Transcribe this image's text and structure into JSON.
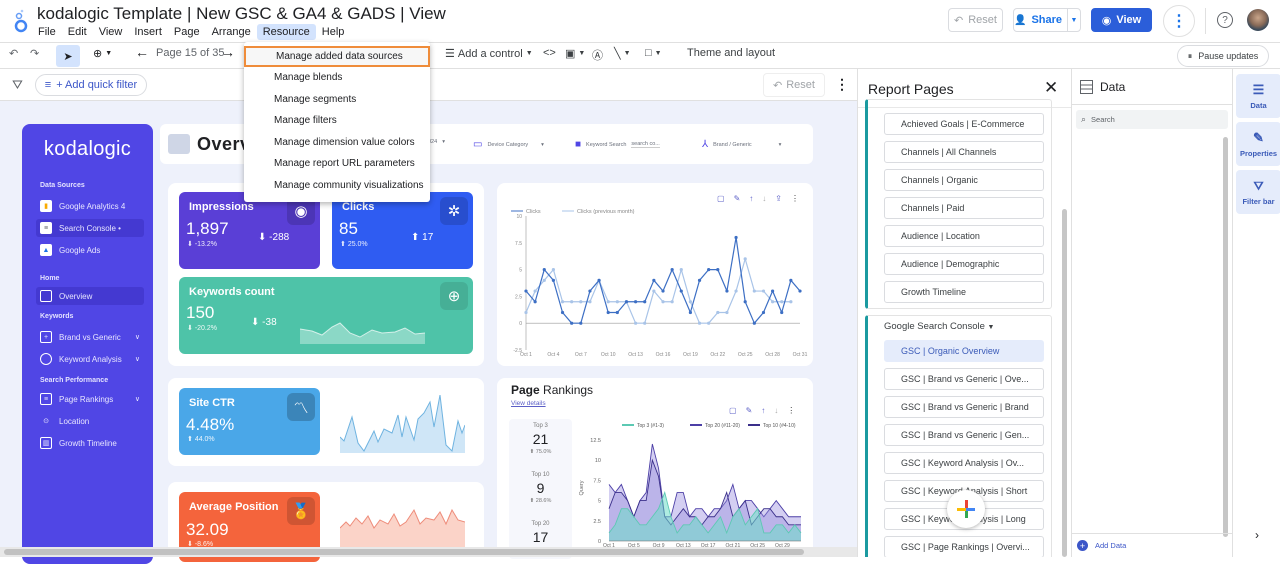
{
  "header": {
    "title": "kodalogic Template | New GSC & GA4 & GADS | View",
    "menus": [
      "File",
      "Edit",
      "View",
      "Insert",
      "Page",
      "Arrange",
      "Resource",
      "Help"
    ],
    "active_menu": "Resource",
    "reset_label": "Reset",
    "share_label": "Share",
    "view_label": "View"
  },
  "toolbar": {
    "page_indicator": "Page 15 of 35",
    "add_control_label": "Add a control",
    "theme_label": "Theme and layout",
    "pause_label": "Pause updates"
  },
  "filterbar": {
    "quick_filter_label": "+ Add quick filter",
    "reset_label": "Reset"
  },
  "resource_menu": {
    "items": [
      "Manage added data sources",
      "Manage blends",
      "Manage segments",
      "Manage filters",
      "Manage dimension value colors",
      "Manage report URL parameters",
      "Manage community visualizations"
    ],
    "highlighted": "Manage added data sources"
  },
  "report": {
    "logo": "kodalogic",
    "page_title": "Overview",
    "sidebar": {
      "sections": {
        "data_sources": "Data Sources",
        "home": "Home",
        "keywords": "Keywords",
        "search_performance": "Search Performance"
      },
      "items": {
        "ga4": "Google Analytics 4",
        "gsc": "Search Console •",
        "ads": "Google Ads",
        "overview": "Overview",
        "brand": "Brand vs Generic",
        "keyword_analysis": "Keyword Analysis",
        "page_rankings": "Page Rankings",
        "location": "Location",
        "growth": "Growth Timeline"
      }
    },
    "controls": {
      "date_fragment": "024",
      "device": "Device Category",
      "keyword_search": "Keyword Search",
      "keyword_placeholder": "search co...",
      "brand": "Brand / Generic"
    },
    "kpis": {
      "impressions": {
        "title": "Impressions",
        "value": "1,897",
        "pct": "-13.2%",
        "delta": "-288",
        "color": "#5a3fd6"
      },
      "clicks": {
        "title": "Clicks",
        "value": "85",
        "pct": "25.0%",
        "delta": "17",
        "color": "#2f5cf2"
      },
      "keywords": {
        "title": "Keywords count",
        "value": "150",
        "pct": "-20.2%",
        "delta": "-38",
        "color": "#4ec3a8"
      },
      "ctr": {
        "title": "Site CTR",
        "value": "4.48%",
        "pct": "44.0%",
        "color": "#4aa7e8"
      },
      "position": {
        "title": "Average Position",
        "value": "32.09",
        "pct": "-8.6%",
        "color": "#f4643c"
      }
    },
    "page_rankings": {
      "title_bold": "Page",
      "title_rest": " Rankings",
      "link": "View details",
      "stats": [
        {
          "label": "Top 3",
          "value": "21",
          "pct": "75.0%"
        },
        {
          "label": "Top 10",
          "value": "9",
          "pct": "28.6%"
        },
        {
          "label": "Top 20",
          "value": "17"
        }
      ]
    }
  },
  "chart_data": [
    {
      "type": "line",
      "title": "Clicks",
      "series": [
        {
          "name": "Clicks",
          "values": [
            3,
            2,
            5,
            4,
            1,
            0,
            0,
            3,
            4,
            1,
            1,
            2,
            2,
            2,
            4,
            3,
            5,
            3,
            1,
            4,
            5,
            5,
            3,
            8,
            2,
            0,
            1,
            3,
            1,
            4,
            3
          ]
        },
        {
          "name": "Clicks (previous month)",
          "values": [
            1,
            3,
            4,
            5,
            2,
            2,
            2,
            2,
            4,
            2,
            2,
            2,
            0,
            0,
            3,
            2,
            2,
            5,
            2,
            0,
            0,
            1,
            1,
            3,
            6,
            3,
            3,
            2,
            2,
            2
          ]
        }
      ],
      "x_ticks": [
        "Oct 1",
        "Oct 4",
        "Oct 7",
        "Oct 10",
        "Oct 13",
        "Oct 16",
        "Oct 19",
        "Oct 22",
        "Oct 25",
        "Oct 28",
        "Oct 31"
      ],
      "y_ticks": [
        "-2.5",
        "0",
        "2.5",
        "5",
        "7.5",
        "10"
      ],
      "ylim": [
        -2.5,
        10
      ],
      "legend": "top-left"
    },
    {
      "type": "area",
      "title": "Page Rankings",
      "ylabel": "Query",
      "series": [
        {
          "name": "Top 3 (#1-3)",
          "values": [
            1,
            2,
            4,
            4,
            3,
            2,
            2,
            3,
            4,
            6,
            3,
            1,
            2,
            2,
            3,
            2,
            1,
            2,
            3,
            1,
            3,
            4,
            2,
            3,
            4,
            1,
            1,
            2,
            2,
            1,
            2,
            1
          ]
        },
        {
          "name": "Top 20 (#11-20)",
          "values": [
            7,
            6,
            7,
            5,
            3,
            5,
            6,
            12,
            9,
            3,
            3,
            6,
            6,
            3,
            4,
            4,
            3,
            4,
            4,
            5,
            7,
            4,
            5,
            5,
            4,
            3,
            4,
            5,
            4,
            3,
            3,
            3
          ]
        },
        {
          "name": "Top 10 (#4-10)",
          "values": [
            4,
            6,
            6,
            5,
            3,
            5,
            5,
            10,
            8,
            3,
            2,
            3,
            4,
            3,
            3,
            2,
            3,
            3,
            4,
            6,
            3,
            4,
            5,
            2,
            3,
            4,
            4,
            3,
            3,
            2,
            2,
            2
          ]
        }
      ],
      "x_ticks": [
        "Oct 1",
        "Oct 5",
        "Oct 9",
        "Oct 13",
        "Oct 17",
        "Oct 21",
        "Oct 25",
        "Oct 29"
      ],
      "y_ticks": [
        "0",
        "2.5",
        "5",
        "7.5",
        "10",
        "12.5"
      ],
      "ylim": [
        0,
        12.5
      ],
      "legend": "top"
    }
  ],
  "report_pages": {
    "title": "Report Pages",
    "group1": [
      "Achieved Goals | E-Commerce",
      "Channels | All Channels",
      "Channels | Organic",
      "Channels | Paid",
      "Audience | Location",
      "Audience | Demographic",
      "Growth Timeline"
    ],
    "gsc_group_label": "Google Search Console",
    "group2": [
      "GSC | Organic Overview",
      "GSC | Brand vs Generic | Ove...",
      "GSC | Brand vs Generic | Brand",
      "GSC | Brand vs Generic | Gen...",
      "GSC | Keyword Analysis | Ov...",
      "GSC | Keyword Analysis | Short",
      "GSC | Keyword Analysis | Long",
      "GSC | Page Rankings | Overvi..."
    ],
    "active": "GSC | Organic Overview"
  },
  "data_panel": {
    "title": "Data",
    "search_placeholder": "Search",
    "add_data": "Add Data"
  },
  "rail": {
    "tabs": [
      "Data",
      "Properties",
      "Filter bar"
    ]
  }
}
